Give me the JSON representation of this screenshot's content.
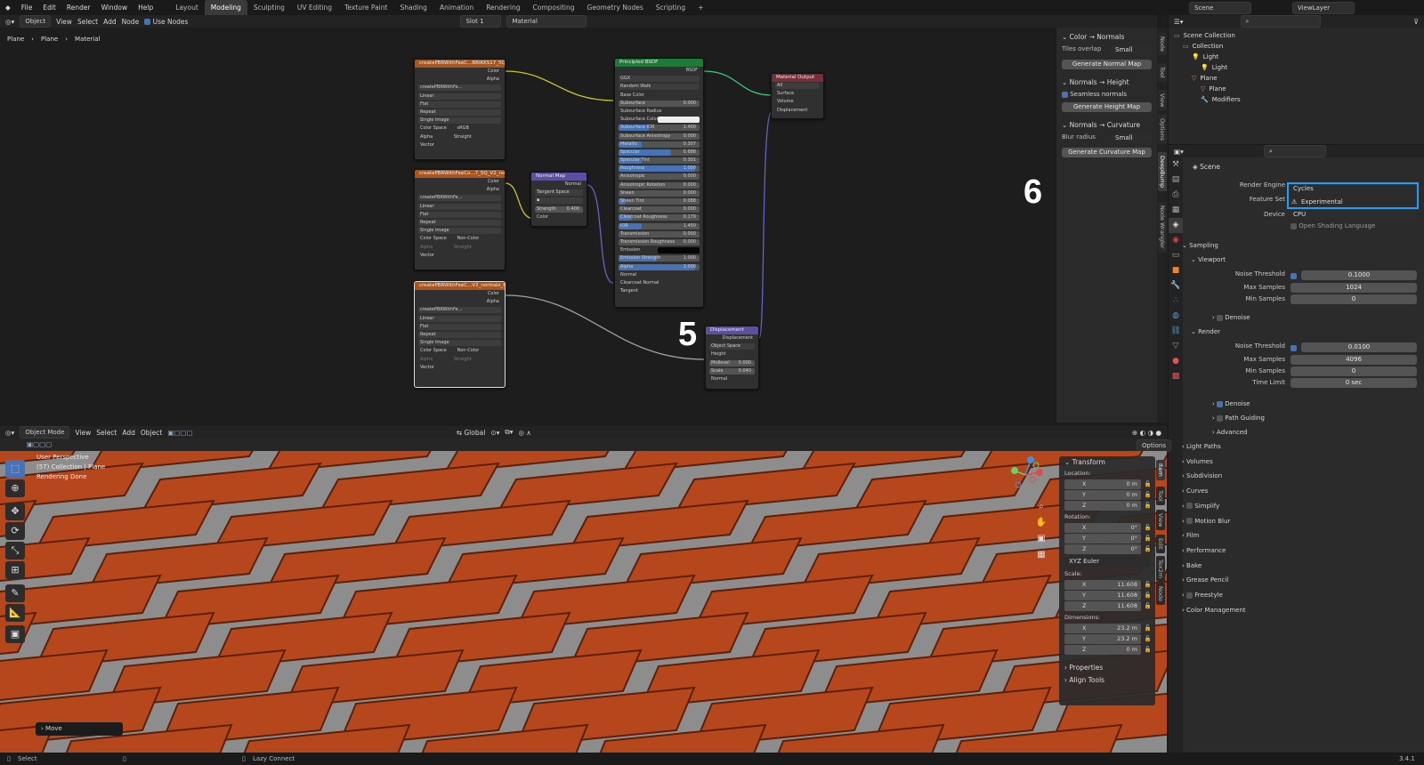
{
  "menu": [
    "File",
    "Edit",
    "Render",
    "Window",
    "Help"
  ],
  "workspaces": [
    {
      "label": "Layout",
      "active": false
    },
    {
      "label": "Modeling",
      "active": true
    },
    {
      "label": "Sculpting",
      "active": false
    },
    {
      "label": "UV Editing",
      "active": false
    },
    {
      "label": "Texture Paint",
      "active": false
    },
    {
      "label": "Shading",
      "active": false
    },
    {
      "label": "Animation",
      "active": false
    },
    {
      "label": "Rendering",
      "active": false
    },
    {
      "label": "Compositing",
      "active": false
    },
    {
      "label": "Geometry Nodes",
      "active": false
    },
    {
      "label": "Scripting",
      "active": false
    }
  ],
  "add_tab": "+",
  "scene_name": "Scene",
  "view_layer": "ViewLayer",
  "node_header": {
    "mode": "Object",
    "view": "View",
    "select": "Select",
    "add": "Add",
    "node": "Node",
    "use_nodes": "Use Nodes",
    "slot": "Slot 1",
    "material": "Material"
  },
  "breadcrumb": [
    "Plane",
    "Plane",
    "Material"
  ],
  "nodes": {
    "img1": {
      "title": "createPBRWithFeeC...BRIKKS17_5Q_V2.jpg",
      "image": "createPBRWithFe...",
      "rows": [
        "Linear",
        "Flat",
        "Repeat",
        "Single Image"
      ],
      "colorspace_label": "Color Space",
      "colorspace": "sRGB",
      "alpha_label": "Alpha",
      "alpha": "Straight",
      "out_color": "Color",
      "out_alpha": "Alpha",
      "in_vector": "Vector"
    },
    "img2": {
      "title": "createPBRWithFeeCo...7_5Q_V2_normals.jpg",
      "image": "createPBRWithFe...",
      "rows": [
        "Linear",
        "Flat",
        "Repeat",
        "Single Image"
      ],
      "colorspace_label": "Color Space",
      "colorspace": "Non-Color",
      "alpha_label": "Alpha",
      "alpha": "Straight",
      "out_color": "Color",
      "out_alpha": "Alpha",
      "in_vector": "Vector"
    },
    "img3": {
      "title": "createPBRWithFeeC...V2_normals_height.jpg",
      "image": "createPBRWithFe...",
      "rows": [
        "Linear",
        "Flat",
        "Repeat",
        "Single Image"
      ],
      "colorspace_label": "Color Space",
      "colorspace": "Non-Color",
      "alpha_label": "Alpha",
      "alpha": "Straight",
      "out_color": "Color",
      "out_alpha": "Alpha",
      "in_vector": "Vector"
    },
    "normal_map": {
      "title": "Normal Map",
      "out": "Normal",
      "space": "Tangent Space",
      "strength_label": "Strength",
      "strength": "0.400",
      "in_color": "Color"
    },
    "bsdf": {
      "title": "Principled BSDF",
      "out": "BSDF",
      "dist": "GGX",
      "sss_method": "Random Walk",
      "rows": [
        [
          "Base Color",
          ""
        ],
        [
          "Subsurface",
          "0.000"
        ],
        [
          "Subsurface Radius",
          ""
        ],
        [
          "Subsurface Color",
          ""
        ],
        [
          "Subsurface IOR",
          "1.400"
        ],
        [
          "Subsurface Anisotropy",
          "0.000"
        ],
        [
          "Metallic",
          "0.307"
        ],
        [
          "Specular",
          "0.688"
        ],
        [
          "Specular Tint",
          "0.301"
        ],
        [
          "Roughness",
          "1.000"
        ],
        [
          "Anisotropic",
          "0.000"
        ],
        [
          "Anisotropic Rotation",
          "0.000"
        ],
        [
          "Sheen",
          "0.000"
        ],
        [
          "Sheen Tint",
          "0.088"
        ],
        [
          "Clearcoat",
          "0.000"
        ],
        [
          "Clearcoat Roughness",
          "0.179"
        ],
        [
          "IOR",
          "1.450"
        ],
        [
          "Transmission",
          "0.000"
        ],
        [
          "Transmission Roughness",
          "0.000"
        ],
        [
          "Emission",
          ""
        ],
        [
          "Emission Strength",
          "1.000"
        ],
        [
          "Alpha",
          "1.000"
        ],
        [
          "Normal",
          ""
        ],
        [
          "Clearcoat Normal",
          ""
        ],
        [
          "Tangent",
          ""
        ]
      ]
    },
    "output": {
      "title": "Material Output",
      "target": "All",
      "inputs": [
        "Surface",
        "Volume",
        "Displacement"
      ]
    },
    "displacement": {
      "title": "Displacement",
      "out": "Displacement",
      "space": "Object Space",
      "inputs": [
        "Height"
      ],
      "midlevel_label": "Midlevel",
      "midlevel": "0.000",
      "scale_label": "Scale",
      "scale": "0.040",
      "normal": "Normal"
    }
  },
  "annotations": {
    "five": "5",
    "six": "6"
  },
  "side_panel": {
    "color_normals": {
      "title": "Color → Normals",
      "tiles_label": "Tiles overlap",
      "tiles": "Small",
      "button": "Generate Normal Map"
    },
    "normals_height": {
      "title": "Normals → Height",
      "seamless": "Seamless normals",
      "button": "Generate Height Map"
    },
    "normals_curv": {
      "title": "Normals → Curvature",
      "blur_label": "Blur radius",
      "blur": "Small",
      "button": "Generate Curvature Map"
    },
    "tabs": [
      "Node",
      "Tool",
      "View",
      "Options",
      "DeepBump",
      "Node Wrangler"
    ]
  },
  "outliner": {
    "items": [
      {
        "label": "Scene Collection",
        "indent": 0
      },
      {
        "label": "Collection",
        "indent": 1
      },
      {
        "label": "Light",
        "indent": 2
      },
      {
        "label": "Light",
        "indent": 3
      },
      {
        "label": "Plane",
        "indent": 2
      },
      {
        "label": "Plane",
        "indent": 3
      },
      {
        "label": "Modifiers",
        "indent": 3
      }
    ]
  },
  "properties": {
    "context": "Scene",
    "render_engine_label": "Render Engine",
    "render_engine": "Cycles",
    "feature_set_label": "Feature Set",
    "feature_set": "Experimental",
    "device_label": "Device",
    "device": "CPU",
    "osl": "Open Shading Language",
    "sampling": "Sampling",
    "viewport": "Viewport",
    "vp_noise_label": "Noise Threshold",
    "vp_noise": "0.1000",
    "vp_max_label": "Max Samples",
    "vp_max": "1024",
    "vp_min_label": "Min Samples",
    "vp_min": "0",
    "denoise": "Denoise",
    "render": "Render",
    "r_noise_label": "Noise Threshold",
    "r_noise": "0.0100",
    "r_max_label": "Max Samples",
    "r_max": "4096",
    "r_min_label": "Min Samples",
    "r_min": "0",
    "r_time_label": "Time Limit",
    "r_time": "0 sec",
    "r_denoise": "Denoise",
    "path_guiding": "Path Guiding",
    "advanced": "Advanced",
    "sections": [
      "Light Paths",
      "Volumes",
      "Subdivision",
      "Curves",
      "Simplify",
      "Motion Blur",
      "Film",
      "Performance",
      "Bake",
      "Grease Pencil",
      "Freestyle",
      "Color Management"
    ]
  },
  "viewport_header": {
    "mode": "Object Mode",
    "view": "View",
    "select": "Select",
    "add": "Add",
    "object": "Object",
    "orientation": "Global",
    "options": "Options"
  },
  "viewport_overlay": {
    "line1": "User Perspective",
    "line2": "(57) Collection | Plane",
    "line3": "Rendering Done",
    "last_op": "Move"
  },
  "n_panel": {
    "tabs": [
      "Item",
      "Tool",
      "View",
      "Edit",
      "Tex2m",
      "Node"
    ],
    "transform": "Transform",
    "location": "Location:",
    "loc": [
      [
        "X",
        "0 m"
      ],
      [
        "Y",
        "0 m"
      ],
      [
        "Z",
        "0 m"
      ]
    ],
    "rotation": "Rotation:",
    "rot": [
      [
        "X",
        "0°"
      ],
      [
        "Y",
        "0°"
      ],
      [
        "Z",
        "0°"
      ]
    ],
    "euler": "XYZ Euler",
    "scale": "Scale:",
    "scl": [
      [
        "X",
        "11.608"
      ],
      [
        "Y",
        "11.608"
      ],
      [
        "Z",
        "11.608"
      ]
    ],
    "dimensions": "Dimensions:",
    "dim": [
      [
        "X",
        "23.2 m"
      ],
      [
        "Y",
        "23.2 m"
      ],
      [
        "Z",
        "0 m"
      ]
    ],
    "properties": "Properties",
    "align": "Align Tools"
  },
  "status_bar": {
    "select": "Select",
    "lazy": "Lazy Connect",
    "version": "3.4.1"
  },
  "colors": {
    "accent": "#4772b3",
    "highlight": "#1ea0ff",
    "image_node": "#a8561e",
    "bsdf": "#1f7a3a",
    "output": "#7a2f38",
    "vector": "#5a4fa0",
    "brick": "#b6471d"
  }
}
